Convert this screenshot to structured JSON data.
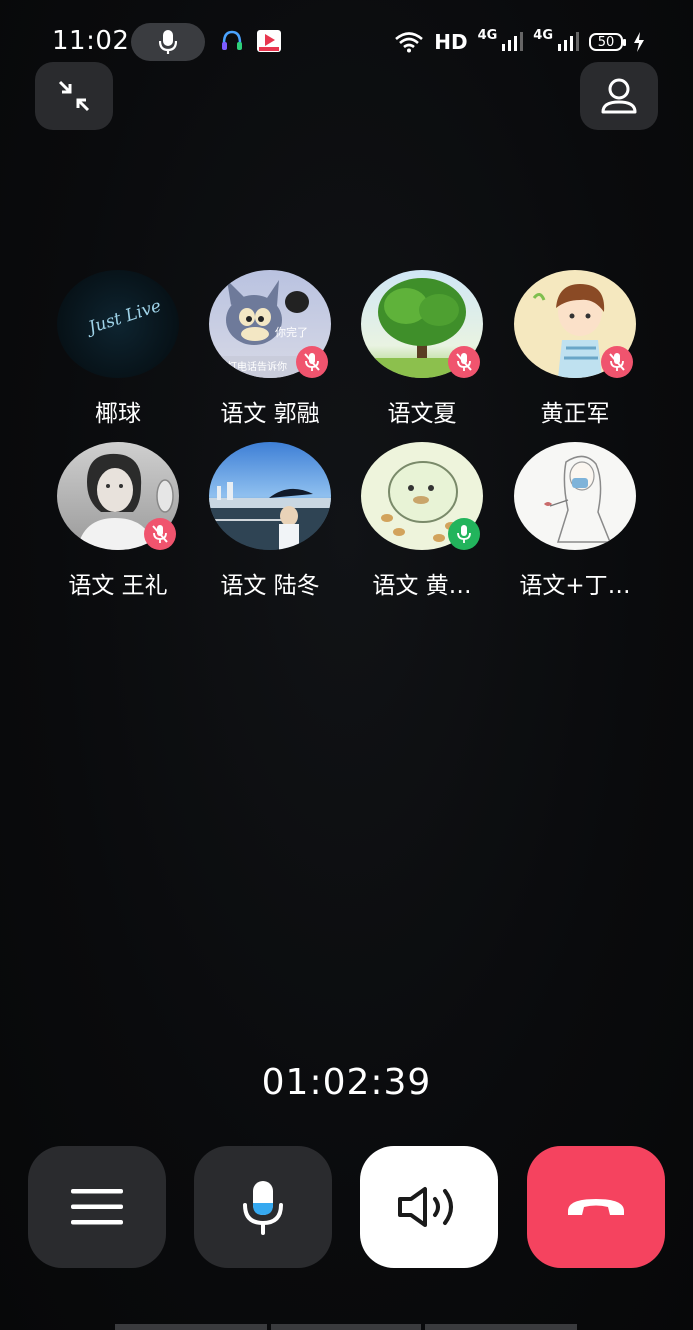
{
  "status_bar": {
    "time": "11:02",
    "network": "HD",
    "sim1": "4G",
    "sim2": "4G",
    "battery": "50"
  },
  "participants": [
    {
      "name": "椰球",
      "muted": null,
      "avatar": "just-live-avatar"
    },
    {
      "name": "语文 郭融",
      "muted": true,
      "avatar": "cartoon-cat-avatar"
    },
    {
      "name": "语文夏",
      "muted": true,
      "avatar": "tree-avatar"
    },
    {
      "name": "黄正军",
      "muted": true,
      "avatar": "cartoon-boy-avatar"
    },
    {
      "name": "语文 王礼",
      "muted": true,
      "avatar": "vintage-portrait-avatar"
    },
    {
      "name": "语文 陆冬",
      "muted": null,
      "avatar": "waterfront-photo-avatar"
    },
    {
      "name": "语文 黄…",
      "muted": false,
      "avatar": "cute-blob-avatar"
    },
    {
      "name": "语文+丁…",
      "muted": null,
      "avatar": "sketch-girl-avatar"
    }
  ],
  "avatar_texts": {
    "just_live": "Just Live",
    "cat_caption": "你完了",
    "cat_subcaption": "打电话告诉你"
  },
  "call": {
    "duration": "01:02:39"
  },
  "colors": {
    "muted_badge": "#f0546e",
    "live_badge": "#22b45c",
    "hangup": "#f5435f",
    "mic_accent": "#36a9f0"
  }
}
